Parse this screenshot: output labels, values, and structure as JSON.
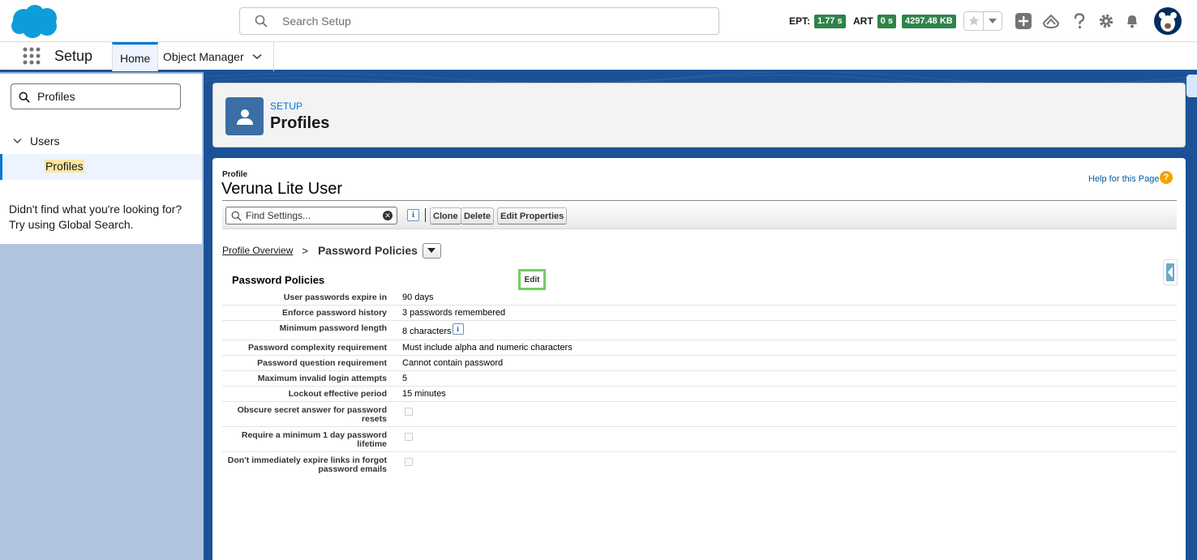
{
  "header": {
    "search_placeholder": "Search Setup",
    "perf": [
      {
        "label": "EPT:",
        "value": "1.77 s"
      },
      {
        "label": "ART",
        "value": "0 s"
      },
      {
        "label": "",
        "value": "4297.48 KB"
      }
    ],
    "icons": [
      "salesforce-cloud-logo",
      "search-icon",
      "star-icon",
      "chevron-down-icon",
      "plus-icon",
      "trailhead-icon",
      "help-icon",
      "gear-icon",
      "bell-icon",
      "avatar"
    ]
  },
  "context": {
    "app_name": "Setup",
    "tabs": [
      {
        "label": "Home"
      },
      {
        "label": "Object Manager"
      }
    ]
  },
  "sidebar": {
    "quick_find_value": "Profiles",
    "parent": "Users",
    "child": "Profiles",
    "help_text": "Didn't find what you're looking for? Try using Global Search."
  },
  "page_header": {
    "eyebrow": "SETUP",
    "title": "Profiles"
  },
  "content": {
    "profile_label": "Profile",
    "profile_name": "Veruna Lite User",
    "help_link": "Help for this Page",
    "help_icon": "?",
    "find_placeholder": "Find Settings...",
    "info_glyph": "i",
    "buttons": {
      "clone": "Clone",
      "delete": "Delete",
      "edit_properties": "Edit Properties"
    },
    "breadcrumb": {
      "link": "Profile Overview",
      "sep": ">",
      "current": "Password Policies"
    },
    "section_title": "Password Policies",
    "edit_label": "Edit",
    "rows": [
      {
        "label": "User passwords expire in",
        "value": "90 days"
      },
      {
        "label": "Enforce password history",
        "value": "3 passwords remembered"
      },
      {
        "label": "Minimum password length",
        "value": "8 characters"
      },
      {
        "label": "Password complexity requirement",
        "value": "Must include alpha and numeric characters"
      },
      {
        "label": "Password question requirement",
        "value": "Cannot contain password"
      },
      {
        "label": "Maximum invalid login attempts",
        "value": "5"
      },
      {
        "label": "Lockout effective period",
        "value": "15 minutes"
      },
      {
        "label": "Obscure secret answer for password resets",
        "checked": false
      },
      {
        "label": "Require a minimum 1 day password lifetime",
        "checked": false
      },
      {
        "label": "Don't immediately expire links in forgot password emails",
        "checked": false
      }
    ]
  },
  "colors": {
    "brand_blue": "#0176d3",
    "perf_green": "#2e844a",
    "edit_highlight": "#6fcf5e",
    "help_orange": "#f0a500"
  }
}
